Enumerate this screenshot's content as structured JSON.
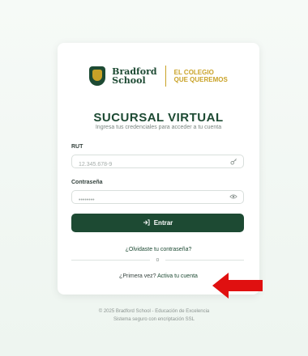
{
  "brand": {
    "school_line1": "Bradford",
    "school_line2": "School",
    "tagline_line1": "EL COLEGIO",
    "tagline_line2": "QUE QUEREMOS"
  },
  "header": {
    "title": "SUCURSAL VIRTUAL",
    "subtitle": "Ingresa tus credenciales para acceder a tu cuenta"
  },
  "form": {
    "rut_label": "RUT",
    "rut_placeholder": "12.345.678-9",
    "password_label": "Contraseña",
    "password_placeholder": "••••••••",
    "submit_label": "Entrar",
    "forgot_link": "¿Olvidaste tu contraseña?",
    "or_text": "o",
    "first_time_prefix": "¿Primera vez? ",
    "first_time_link": "Activa tu cuenta"
  },
  "footer": {
    "line1": "© 2025 Bradford School - Educación de Excelencia",
    "line2": "Sistema seguro con encriptación SSL"
  },
  "icons": {
    "rut_icon": "key-icon",
    "password_icon": "eye-icon",
    "submit_icon": "login-arrow-icon",
    "annotation": "red-arrow-icon"
  },
  "colors": {
    "brand_green": "#1d4a33",
    "brand_gold": "#c9a227",
    "annotation_red": "#e01010"
  }
}
